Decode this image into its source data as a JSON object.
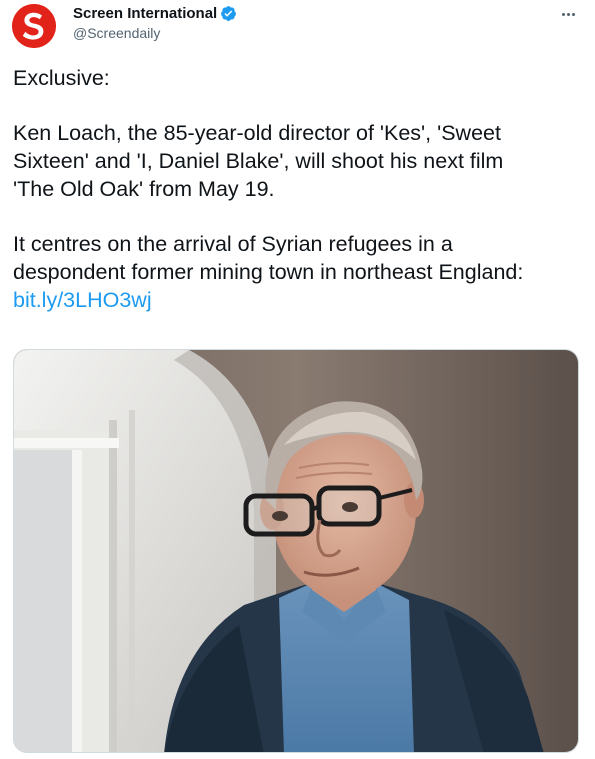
{
  "account": {
    "display_name": "Screen International",
    "handle": "@Screendaily",
    "avatar_letter": "S",
    "avatar_color": "#e2231a",
    "verified": true
  },
  "tweet": {
    "paragraph1": "Exclusive:",
    "paragraph2": "Ken Loach, the 85-year-old director of 'Kes', 'Sweet\nSixteen' and 'I, Daniel Blake', will shoot his next film\n'The Old Oak' from May 19.",
    "paragraph3": "It centres on the arrival of Syrian refugees in a\ndespondent former mining town in northeast England:",
    "link_text": "bit.ly/3LHO3wj"
  },
  "icons": {
    "more": "more-options-icon",
    "verified": "verified-badge-icon"
  },
  "colors": {
    "text": "#0f1419",
    "secondary": "#536471",
    "link": "#1d9bf0",
    "verified": "#1d9bf0"
  }
}
